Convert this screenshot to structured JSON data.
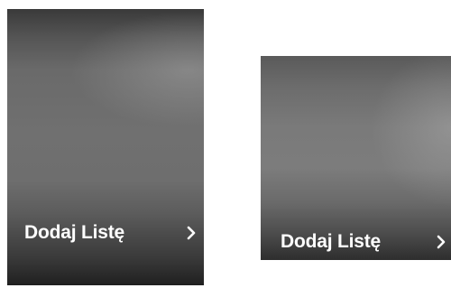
{
  "cards": [
    {
      "label": "Dodaj Listę",
      "icon": "chevron-right-icon"
    },
    {
      "label": "Dodaj Listę",
      "icon": "chevron-right-icon"
    }
  ],
  "colors": {
    "label_text": "#ffffff",
    "card_dark": "#202020",
    "card_mid": "#707070",
    "background": "#ffffff"
  }
}
